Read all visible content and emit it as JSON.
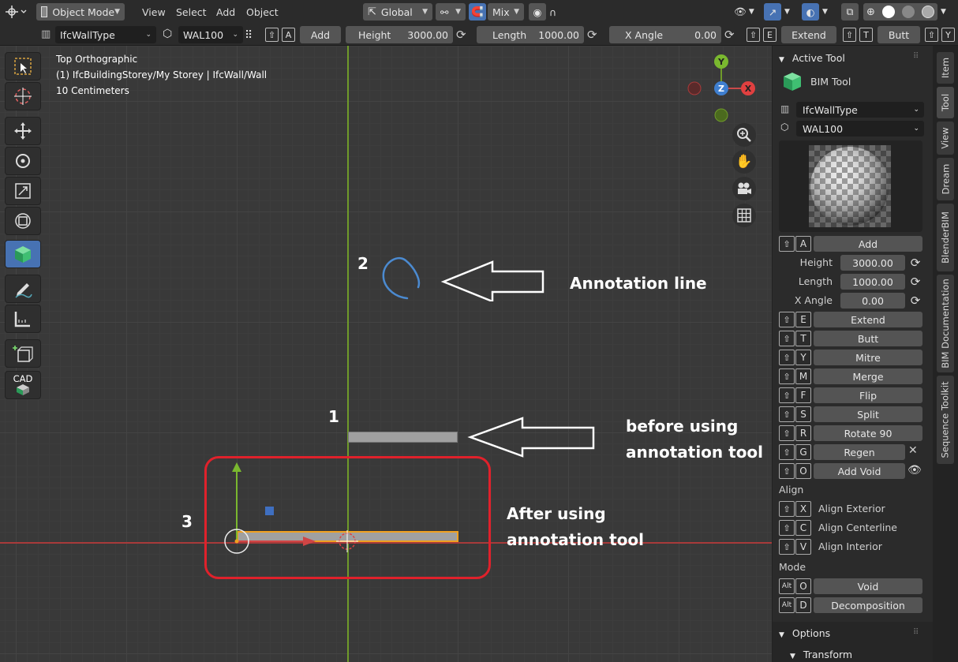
{
  "header": {
    "mode_label": "Object Mode",
    "menus": [
      "View",
      "Select",
      "Add",
      "Object"
    ],
    "orientation_label": "Global",
    "snap_label": "Mix"
  },
  "tool_header": {
    "type_label": "IfcWallType",
    "mesh_label": "WAL100",
    "add_label": "Add",
    "height_label": "Height",
    "height_value": "3000.00",
    "length_label": "Length",
    "length_value": "1000.00",
    "xangle_label": "X Angle",
    "xangle_value": "0.00",
    "extend_label": "Extend",
    "butt_label": "Butt",
    "key_a": "A",
    "key_e": "E",
    "key_t": "T",
    "key_y": "Y"
  },
  "viewport": {
    "view_name": "Top Orthographic",
    "collection": "(1) IfcBuildingStorey/My Storey | IfcWall/Wall",
    "scale": "10 Centimeters",
    "gizmo_y": "Y",
    "gizmo_z": "Z",
    "gizmo_x": "X",
    "cad_label": "CAD"
  },
  "annotations": {
    "n1": "1",
    "n2": "2",
    "n3": "3",
    "annotation_line": "Annotation line",
    "before_line1": "before using",
    "before_line2": "annotation tool",
    "after_line1": "After using",
    "after_line2": "annotation tool"
  },
  "sidebar": {
    "active_tool_title": "Active Tool",
    "tool_name": "BIM Tool",
    "type_value": "IfcWallType",
    "mesh_value": "WAL100",
    "add_label": "Add",
    "height_label": "Height",
    "height_value": "3000.00",
    "length_label": "Length",
    "length_value": "1000.00",
    "xangle_label": "X Angle",
    "xangle_value": "0.00",
    "actions": [
      {
        "key": "E",
        "label": "Extend"
      },
      {
        "key": "T",
        "label": "Butt"
      },
      {
        "key": "Y",
        "label": "Mitre"
      },
      {
        "key": "M",
        "label": "Merge"
      },
      {
        "key": "F",
        "label": "Flip"
      },
      {
        "key": "S",
        "label": "Split"
      },
      {
        "key": "R",
        "label": "Rotate 90"
      },
      {
        "key": "G",
        "label": "Regen"
      },
      {
        "key": "O",
        "label": "Add Void"
      }
    ],
    "key_a": "A",
    "align_title": "Align",
    "align_items": [
      {
        "key": "X",
        "label": "Align Exterior"
      },
      {
        "key": "C",
        "label": "Align Centerline"
      },
      {
        "key": "V",
        "label": "Align Interior"
      }
    ],
    "mode_title": "Mode",
    "mode_items": [
      {
        "mod": "Alt",
        "key": "O",
        "label": "Void"
      },
      {
        "mod": "Alt",
        "key": "D",
        "label": "Decomposition"
      }
    ],
    "options_title": "Options",
    "transform_title": "Transform"
  },
  "tabs": [
    "Item",
    "Tool",
    "View",
    "Dream",
    "BlenderBIM",
    "BIM Documentation",
    "Sequence Toolkit"
  ],
  "colors": {
    "accent_blue": "#4772b3",
    "highlight_red": "#e0212b",
    "axis_green": "#6f9a2a",
    "axis_red": "#a83a3a",
    "wall_gray": "#a0a0a0",
    "wall_selected_outline": "#f0a020"
  }
}
